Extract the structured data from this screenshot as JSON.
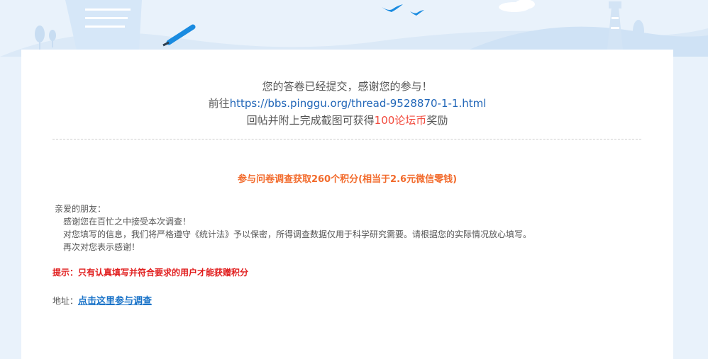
{
  "thanks": {
    "line1": "您的答卷已经提交，感谢您的参与！",
    "line2_prefix": "前往",
    "line2_link": "https://bbs.pinggu.org/thread-9528870-1-1.html",
    "line3_prefix": "回帖并附上完成截图可获得",
    "line3_highlight": "100论坛币",
    "line3_suffix": "奖励"
  },
  "survey": {
    "title": "参与问卷调查获取260个积分(相当于2.6元微信零钱)"
  },
  "letter": {
    "greeting": "亲爱的朋友：",
    "p1": "感谢您在百忙之中接受本次调查！",
    "p2": "对您填写的信息，我们将严格遵守《统计法》予以保密，所得调查数据仅用于科学研究需要。请根据您的实际情况放心填写。",
    "p3": "再次对您表示感谢！"
  },
  "tip": "提示：只有认真填写并符合要求的用户才能获赠积分",
  "address": {
    "label": "地址：",
    "link_text": "点击这里参与调查"
  },
  "colors": {
    "background": "#e9f2fb",
    "link": "#2166b8",
    "highlight": "#f24b3e",
    "survey_title": "#f26a2b",
    "tip": "#e11d1d"
  }
}
